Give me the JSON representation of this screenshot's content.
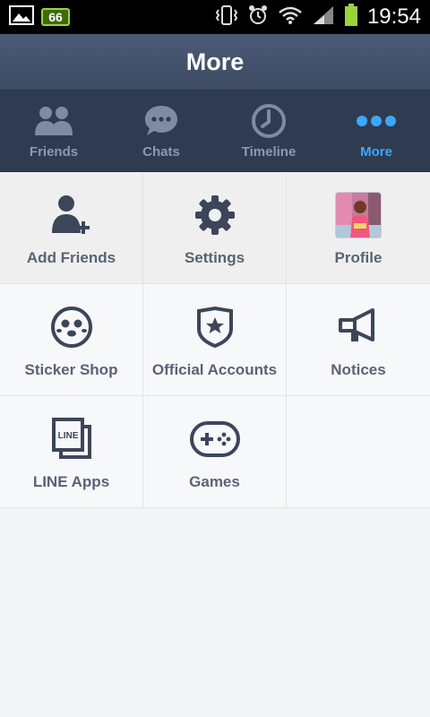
{
  "status_bar": {
    "battery_level": "66",
    "time": "19:54",
    "colors": {
      "battery": "#9bd33b"
    }
  },
  "header": {
    "title": "More"
  },
  "tabs": [
    {
      "label": "Friends",
      "icon": "friends-icon",
      "active": false
    },
    {
      "label": "Chats",
      "icon": "chat-bubble-icon",
      "active": false
    },
    {
      "label": "Timeline",
      "icon": "clock-icon",
      "active": false
    },
    {
      "label": "More",
      "icon": "more-dots-icon",
      "active": true
    }
  ],
  "menu_items": [
    {
      "label": "Add Friends",
      "icon": "add-friend-icon"
    },
    {
      "label": "Settings",
      "icon": "gear-icon"
    },
    {
      "label": "Profile",
      "icon": "profile-photo"
    },
    {
      "label": "Sticker Shop",
      "icon": "sticker-face-icon"
    },
    {
      "label": "Official Accounts",
      "icon": "shield-star-icon"
    },
    {
      "label": "Notices",
      "icon": "megaphone-icon"
    },
    {
      "label": "LINE Apps",
      "icon": "line-apps-icon"
    },
    {
      "label": "Games",
      "icon": "gamepad-icon"
    }
  ],
  "line_apps_icon_text": "LINE",
  "colors": {
    "accent": "#3ea6ff",
    "header_bg": "#4b5b76",
    "tab_bg": "#2f3b50",
    "icon": "#3d4659"
  }
}
